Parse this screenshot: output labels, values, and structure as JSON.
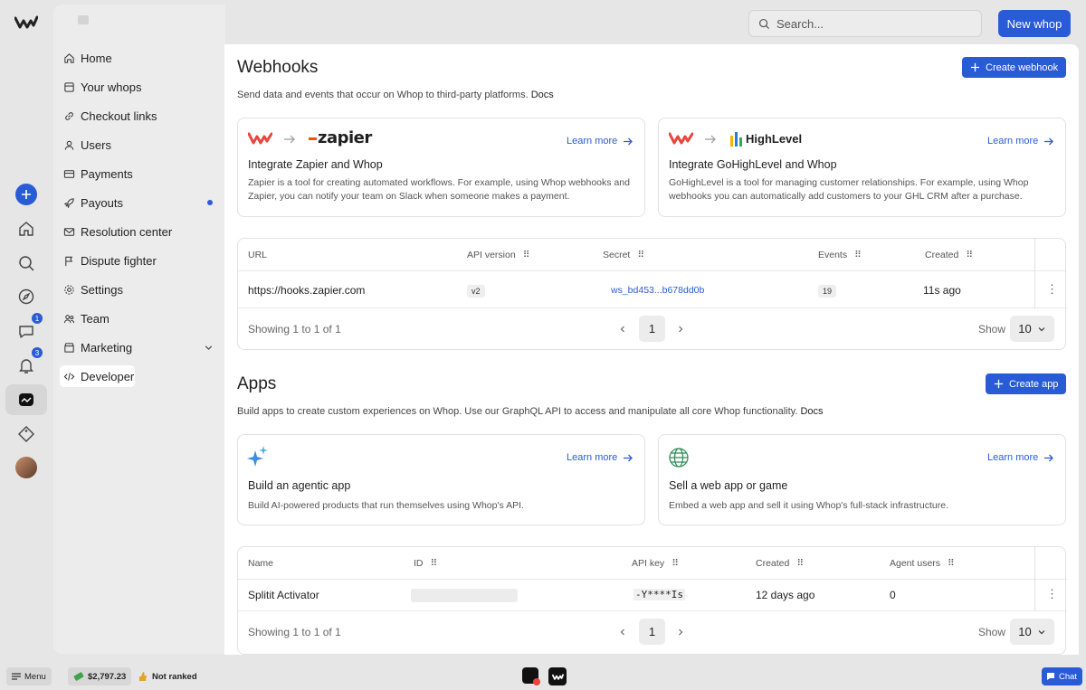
{
  "app": {
    "logo": "whop-logo"
  },
  "topbar": {
    "search_placeholder": "Search...",
    "new_whop": "New whop"
  },
  "rail": {
    "messages_badge": "1",
    "notifications_badge": "3"
  },
  "sidebar": {
    "items": [
      {
        "label": "Home",
        "icon": "home-icon"
      },
      {
        "label": "Your whops",
        "icon": "box-icon"
      },
      {
        "label": "Checkout links",
        "icon": "link-icon"
      },
      {
        "label": "Users",
        "icon": "user-icon"
      },
      {
        "label": "Payments",
        "icon": "card-icon"
      },
      {
        "label": "Payouts",
        "icon": "rocket-icon"
      },
      {
        "label": "Resolution center",
        "icon": "mail-icon"
      },
      {
        "label": "Dispute fighter",
        "icon": "flag-icon"
      },
      {
        "label": "Settings",
        "icon": "gear-icon"
      },
      {
        "label": "Team",
        "icon": "team-icon"
      },
      {
        "label": "Marketing",
        "icon": "store-icon"
      },
      {
        "label": "Developer",
        "icon": "code-icon"
      }
    ]
  },
  "webhooks": {
    "title": "Webhooks",
    "create_label": "Create webhook",
    "description": "Send data and events that occur on Whop to third-party platforms.",
    "docs": "Docs",
    "cards": [
      {
        "brand": "zapier",
        "title": "Integrate Zapier and Whop",
        "text": "Zapier is a tool for creating automated workflows. For example, using Whop webhooks and Zapier, you can notify your team on Slack when someone makes a payment.",
        "learn": "Learn more"
      },
      {
        "brand": "HighLevel",
        "title": "Integrate GoHighLevel and Whop",
        "text": "GoHighLevel is a tool for managing customer relationships. For example, using Whop webhooks you can automatically add customers to your GHL CRM after a purchase.",
        "learn": "Learn more"
      }
    ],
    "table": {
      "columns": [
        "URL",
        "API version",
        "Secret",
        "Events",
        "Created"
      ],
      "rows": [
        {
          "url": "https://hooks.zapier.com",
          "version": "v2",
          "secret": "ws_bd453...b678dd0b",
          "events": "19",
          "created": "11s ago"
        }
      ],
      "showing": "Showing 1 to 1 of 1",
      "page": "1",
      "show_label": "Show",
      "page_size": "10"
    }
  },
  "apps": {
    "title": "Apps",
    "create_label": "Create app",
    "description": "Build apps to create custom experiences on Whop. Use our GraphQL API to access and manipulate all core Whop functionality.",
    "docs": "Docs",
    "cards": [
      {
        "icon": "sparkle-icon",
        "title": "Build an agentic app",
        "text": "Build AI-powered products that run themselves using Whop's API.",
        "learn": "Learn more"
      },
      {
        "icon": "globe-icon",
        "title": "Sell a web app or game",
        "text": "Embed a web app and sell it using Whop's full-stack infrastructure.",
        "learn": "Learn more"
      }
    ],
    "table": {
      "columns": [
        "Name",
        "ID",
        "API key",
        "Created",
        "Agent users"
      ],
      "rows": [
        {
          "name": "Splitit Activator",
          "api_key": "-Y****Is",
          "created": "12 days ago",
          "agent_users": "0"
        }
      ],
      "showing": "Showing 1 to 1 of 1",
      "page": "1",
      "show_label": "Show",
      "page_size": "10"
    }
  },
  "bottombar": {
    "menu": "Menu",
    "balance": "$2,797.23",
    "rank": "Not ranked",
    "chat": "Chat"
  },
  "colors": {
    "accent": "#2a5bd7",
    "brand_red": "#e8453c"
  }
}
